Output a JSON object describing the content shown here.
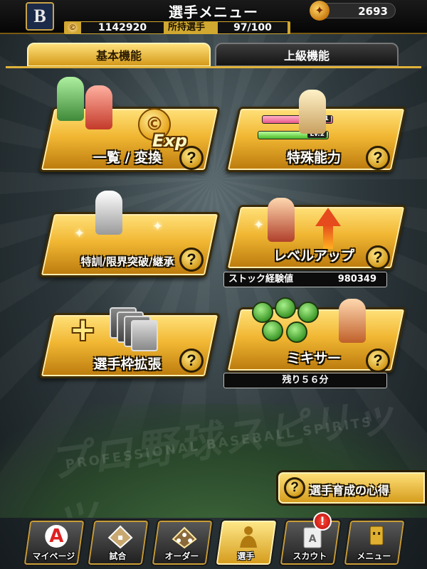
{
  "header": {
    "team_logo_letter": "B",
    "title": "選手メニュー",
    "gem_count": "2693",
    "coin_symbol": "©",
    "coin_count": "1142920",
    "owned_label": "所持選手",
    "owned_count": "97/100"
  },
  "tabs": [
    {
      "label": "基本機能",
      "selected": true
    },
    {
      "label": "上級機能",
      "selected": false
    }
  ],
  "menu": {
    "list_convert": {
      "label": "一覧 / 変換",
      "exp_text": "Exp"
    },
    "special_ability": {
      "label": "特殊能力",
      "level_tags": [
        "Lv.1",
        "Lv.2"
      ]
    },
    "training": {
      "label": "特訓/限界突破/継承"
    },
    "level_up": {
      "label": "レベルアップ",
      "info_label": "ストック経験値",
      "info_value": "980349"
    },
    "slot_expand": {
      "label": "選手枠拡張"
    },
    "mixer": {
      "label": "ミキサー",
      "info_text": "残り５６分"
    },
    "help_glyph": "?"
  },
  "guide_button": {
    "label": "選手育成の心得"
  },
  "nav": [
    {
      "label": "マイページ",
      "icon": "A",
      "active": false
    },
    {
      "label": "試合",
      "icon": "field-icon",
      "active": false
    },
    {
      "label": "オーダー",
      "icon": "order-icon",
      "active": false
    },
    {
      "label": "選手",
      "icon": "player-icon",
      "active": true
    },
    {
      "label": "スカウト",
      "icon": "scout-icon",
      "active": false
    },
    {
      "label": "メニュー",
      "icon": "menu-icon",
      "active": false
    }
  ],
  "alert_badge": "!",
  "background_text": {
    "logo": "プロ野球スピリッツ",
    "sub": "PROFESSIONAL BASEBALL SPIRITS"
  },
  "colors": {
    "gold": "#f1b733",
    "dark": "#1a1200",
    "alert": "#e0201a"
  }
}
